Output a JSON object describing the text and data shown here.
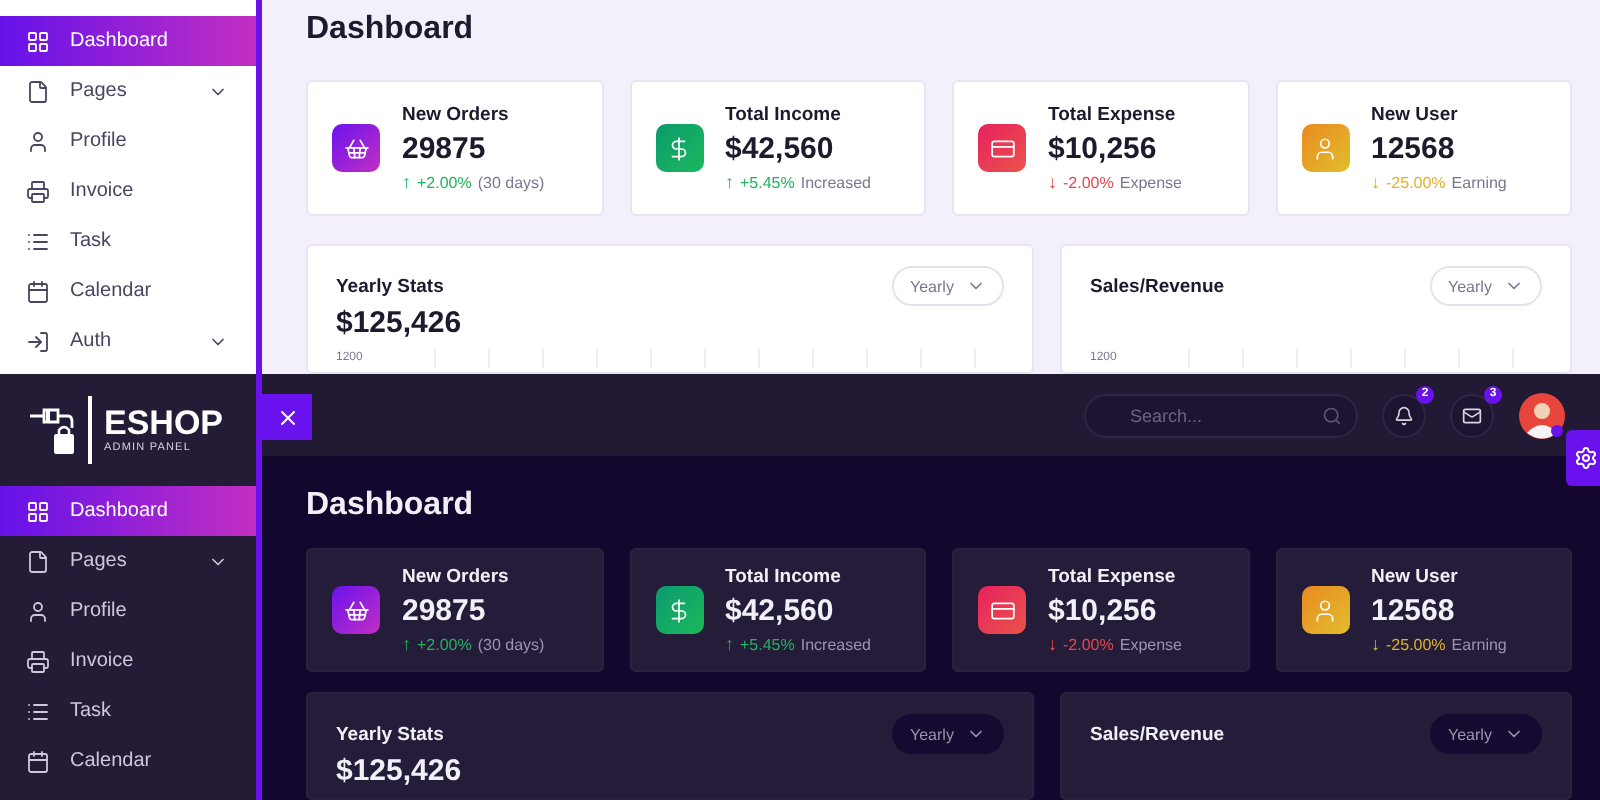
{
  "light_view": {
    "sidebar": {
      "items": [
        {
          "label": "Dashboard",
          "kind": "grid",
          "selected": true,
          "expandable": false
        },
        {
          "label": "Pages",
          "kind": "file",
          "selected": false,
          "expandable": true
        },
        {
          "label": "Profile",
          "kind": "user",
          "selected": false,
          "expandable": false
        },
        {
          "label": "Invoice",
          "kind": "printer",
          "selected": false,
          "expandable": false
        },
        {
          "label": "Task",
          "kind": "list",
          "selected": false,
          "expandable": false
        },
        {
          "label": "Calendar",
          "kind": "calendar",
          "selected": false,
          "expandable": false
        },
        {
          "label": "Auth",
          "kind": "login",
          "selected": false,
          "expandable": true
        }
      ]
    },
    "page_title": "Dashboard",
    "stat_cards": [
      {
        "title": "New Orders",
        "value": "29875",
        "kind": "basket",
        "arrow": "↑",
        "change": "+2.00%",
        "note": "(30 days)",
        "color": "#22b35e"
      },
      {
        "title": "Total Income",
        "value": "$42,560",
        "kind": "dollar",
        "arrow": "↑",
        "change": "+5.45%",
        "note": "Increased",
        "color": "#22b35e"
      },
      {
        "title": "Total Expense",
        "value": "$10,256",
        "kind": "card",
        "arrow": "↓",
        "change": "-2.00%",
        "note": "Expense",
        "color": "#e5484d"
      },
      {
        "title": "New User",
        "value": "12568",
        "kind": "user",
        "arrow": "↓",
        "change": "-25.00%",
        "note": "Earning",
        "color": "#e0b228"
      }
    ],
    "charts": [
      {
        "title": "Yearly Stats",
        "value": "$125,426",
        "filter": "Yearly",
        "y_tick": "1200"
      },
      {
        "title": "Sales/Revenue",
        "filter": "Yearly",
        "y_tick": "1200"
      }
    ]
  },
  "dark_view": {
    "logo": {
      "name": "ESHOP",
      "subtitle": "ADMIN PANEL"
    },
    "header": {
      "search": {
        "placeholder": "Search..."
      },
      "notifications": {
        "badge": "2"
      },
      "messages": {
        "badge": "3"
      }
    },
    "sidebar": {
      "items": [
        {
          "label": "Dashboard",
          "kind": "grid",
          "selected": true,
          "expandable": false
        },
        {
          "label": "Pages",
          "kind": "file",
          "selected": false,
          "expandable": true
        },
        {
          "label": "Profile",
          "kind": "user",
          "selected": false,
          "expandable": false
        },
        {
          "label": "Invoice",
          "kind": "printer",
          "selected": false,
          "expandable": false
        },
        {
          "label": "Task",
          "kind": "list",
          "selected": false,
          "expandable": false
        },
        {
          "label": "Calendar",
          "kind": "calendar",
          "selected": false,
          "expandable": false
        }
      ]
    },
    "page_title": "Dashboard",
    "stat_cards": [
      {
        "title": "New Orders",
        "value": "29875",
        "kind": "basket",
        "arrow": "↑",
        "change": "+2.00%",
        "note": "(30 days)",
        "color": "#22b35e"
      },
      {
        "title": "Total Income",
        "value": "$42,560",
        "kind": "dollar",
        "arrow": "↑",
        "change": "+5.45%",
        "note": "Increased",
        "color": "#22b35e"
      },
      {
        "title": "Total Expense",
        "value": "$10,256",
        "kind": "card",
        "arrow": "↓",
        "change": "-2.00%",
        "note": "Expense",
        "color": "#e5484d"
      },
      {
        "title": "New User",
        "value": "12568",
        "kind": "user",
        "arrow": "↓",
        "change": "-25.00%",
        "note": "Earning",
        "color": "#e0b228"
      }
    ],
    "charts": [
      {
        "title": "Yearly Stats",
        "value": "$125,426",
        "filter": "Yearly"
      },
      {
        "title": "Sales/Revenue",
        "filter": "Yearly"
      }
    ]
  }
}
